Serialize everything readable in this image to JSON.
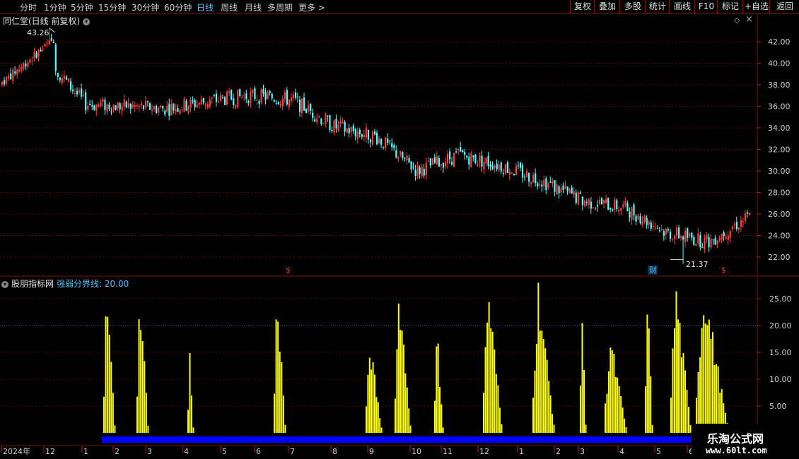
{
  "toolbar": {
    "periods": [
      {
        "label": "分时",
        "active": false
      },
      {
        "label": "1分钟",
        "active": false
      },
      {
        "label": "5分钟",
        "active": false
      },
      {
        "label": "15分钟",
        "active": false
      },
      {
        "label": "30分钟",
        "active": false
      },
      {
        "label": "60分钟",
        "active": false
      },
      {
        "label": "日线",
        "active": true
      },
      {
        "label": "周线",
        "active": false
      },
      {
        "label": "月线",
        "active": false
      },
      {
        "label": "多周期",
        "active": false
      },
      {
        "label": "更多 >",
        "active": false
      }
    ],
    "right_buttons": [
      "复权",
      "叠加",
      "多股",
      "统计",
      "画线",
      "F10",
      "标记",
      "+自选",
      "返回"
    ]
  },
  "main_chart": {
    "title": "同仁堂(日线 前复权)",
    "high_label": "43.26",
    "low_label": "21.37",
    "y_ticks": [
      "42.00",
      "40.00",
      "38.00",
      "36.00",
      "34.00",
      "32.00",
      "30.00",
      "28.00",
      "26.00",
      "24.00",
      "22.00"
    ],
    "markers": [
      {
        "text": "$",
        "color": "#ff3030"
      },
      {
        "text": "财",
        "color": "#4fc3f7"
      },
      {
        "text": "$",
        "color": "#ff3030"
      }
    ]
  },
  "indicator": {
    "name": "股朋指标网",
    "param": "强弱分界线: 20.00",
    "y_ticks": [
      "25.00",
      "20.00",
      "15.00",
      "10.00",
      "5.00"
    ]
  },
  "x_axis": {
    "labels": [
      "2024年",
      "12",
      "1",
      "2",
      "3",
      "4",
      "5",
      "6",
      "7",
      "8",
      "9",
      "10",
      "11",
      "12",
      "1",
      "2",
      "3",
      "4",
      "5",
      "6"
    ]
  },
  "watermark": {
    "cn": "乐淘公式网",
    "url": "www.60lt.com"
  },
  "chart_data": [
    {
      "type": "candlestick-line",
      "title": "同仁堂(日线 前复权)",
      "x": [
        "2023-12",
        "2024-01",
        "2024-02",
        "2024-03",
        "2024-04",
        "2024-05",
        "2024-06",
        "2024-07",
        "2024-08",
        "2024-09",
        "2024-10",
        "2024-11",
        "2024-12",
        "2025-01",
        "2025-02",
        "2025-03",
        "2025-04",
        "2025-05",
        "2025-06"
      ],
      "close": [
        40.5,
        40.8,
        36.2,
        36.0,
        35.8,
        36.5,
        37.0,
        36.6,
        34.1,
        33.2,
        30.0,
        31.5,
        30.5,
        29.1,
        27.2,
        26.6,
        24.3,
        23.4,
        25.8
      ],
      "high_point": 43.26,
      "low_point": 21.37,
      "ylim": [
        21,
        43.5
      ]
    },
    {
      "type": "bar",
      "title": "股朋指标网",
      "reference_line": 20,
      "ylim": [
        0,
        28
      ],
      "x": [
        "2024-01",
        "2024-02",
        "2024-04",
        "2024-06",
        "2024-08",
        "2024-09",
        "2024-10",
        "2024-11",
        "2024-12",
        "2025-01",
        "2025-02",
        "2025-03",
        "2025-04",
        "2025-05"
      ],
      "peaks": [
        28,
        28,
        17,
        28,
        17,
        28,
        20,
        28,
        28,
        28,
        18,
        28,
        28,
        28
      ],
      "baseline_band": true
    }
  ]
}
